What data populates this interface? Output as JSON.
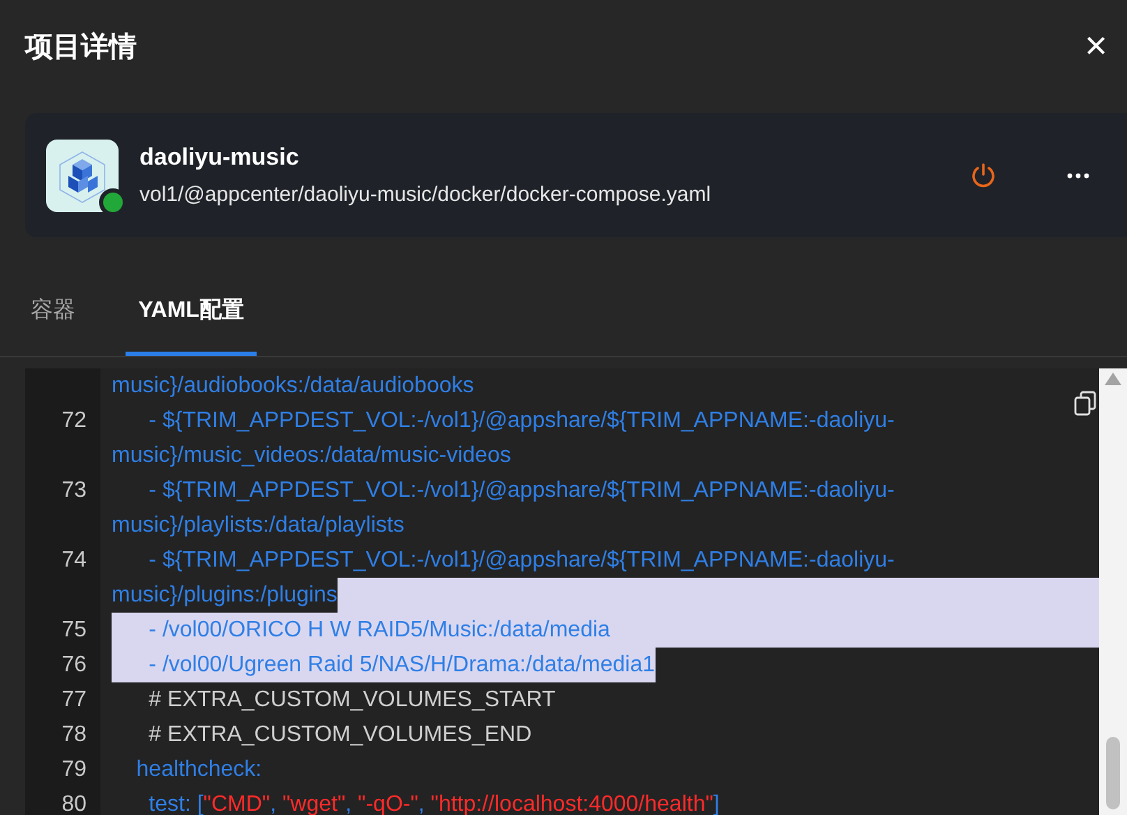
{
  "dialog": {
    "title": "项目详情",
    "close": "×"
  },
  "app": {
    "name": "daoliyu-music",
    "path": "vol1/@appcenter/daoliyu-music/docker/docker-compose.yaml",
    "running": true
  },
  "tabs": [
    {
      "label": "容器",
      "selected": false
    },
    {
      "label": "YAML配置",
      "selected": true
    }
  ],
  "code_lines": [
    {
      "selected": false,
      "tokens": [
        {
          "kind": "key",
          "text": "music}/audiobooks:/data/audiobooks"
        }
      ]
    },
    {
      "number": "72",
      "selected": false,
      "tokens": [
        {
          "kind": "key",
          "text": "      - ${TRIM_APPDEST_VOL:-/vol1}/@appshare/${TRIM_APPNAME:-daoliyu-"
        }
      ]
    },
    {
      "selected": false,
      "tokens": [
        {
          "kind": "key",
          "text": "music}/music_videos:/data/music-videos"
        }
      ]
    },
    {
      "number": "73",
      "selected": false,
      "tokens": [
        {
          "kind": "key",
          "text": "      - ${TRIM_APPDEST_VOL:-/vol1}/@appshare/${TRIM_APPNAME:-daoliyu-"
        }
      ]
    },
    {
      "selected": false,
      "tokens": [
        {
          "kind": "key",
          "text": "music}/playlists:/data/playlists"
        }
      ]
    },
    {
      "number": "74",
      "selected": false,
      "tokens": [
        {
          "kind": "key",
          "text": "      - ${TRIM_APPDEST_VOL:-/vol1}/@appshare/${TRIM_APPNAME:-daoliyu-"
        }
      ]
    },
    {
      "selected": true,
      "kind": "tail",
      "tokens": [
        {
          "kind": "key",
          "text": "music}/plugins:/plugins"
        }
      ]
    },
    {
      "number": "75",
      "selected": true,
      "kind": "full",
      "tokens": [
        {
          "kind": "key",
          "text": "      - /vol00/ORICO H W RAID5/Music:/data/media"
        }
      ]
    },
    {
      "number": "76",
      "selected": true,
      "kind": "text",
      "tokens": [
        {
          "kind": "key",
          "text": "      - /vol00/Ugreen Raid 5/NAS/H/Drama:/data/media1"
        }
      ]
    },
    {
      "number": "77",
      "selected": false,
      "tokens": [
        {
          "kind": "comment",
          "text": "      # EXTRA_CUSTOM_VOLUMES_START"
        }
      ]
    },
    {
      "number": "78",
      "selected": false,
      "tokens": [
        {
          "kind": "comment",
          "text": "      # EXTRA_CUSTOM_VOLUMES_END"
        }
      ]
    },
    {
      "number": "79",
      "selected": false,
      "tokens": [
        {
          "kind": "key",
          "text": "    healthcheck:"
        }
      ]
    },
    {
      "number": "80",
      "selected": false,
      "tokens": [
        {
          "kind": "key",
          "text": "      test: ["
        },
        {
          "kind": "string",
          "text": "\"CMD\""
        },
        {
          "kind": "key",
          "text": ", "
        },
        {
          "kind": "string",
          "text": "\"wget\""
        },
        {
          "kind": "key",
          "text": ", "
        },
        {
          "kind": "string",
          "text": "\"-qO-\""
        },
        {
          "kind": "key",
          "text": ", "
        },
        {
          "kind": "string",
          "text": "\"http://localhost:4000/health\""
        },
        {
          "kind": "key",
          "text": "]"
        }
      ]
    }
  ]
}
